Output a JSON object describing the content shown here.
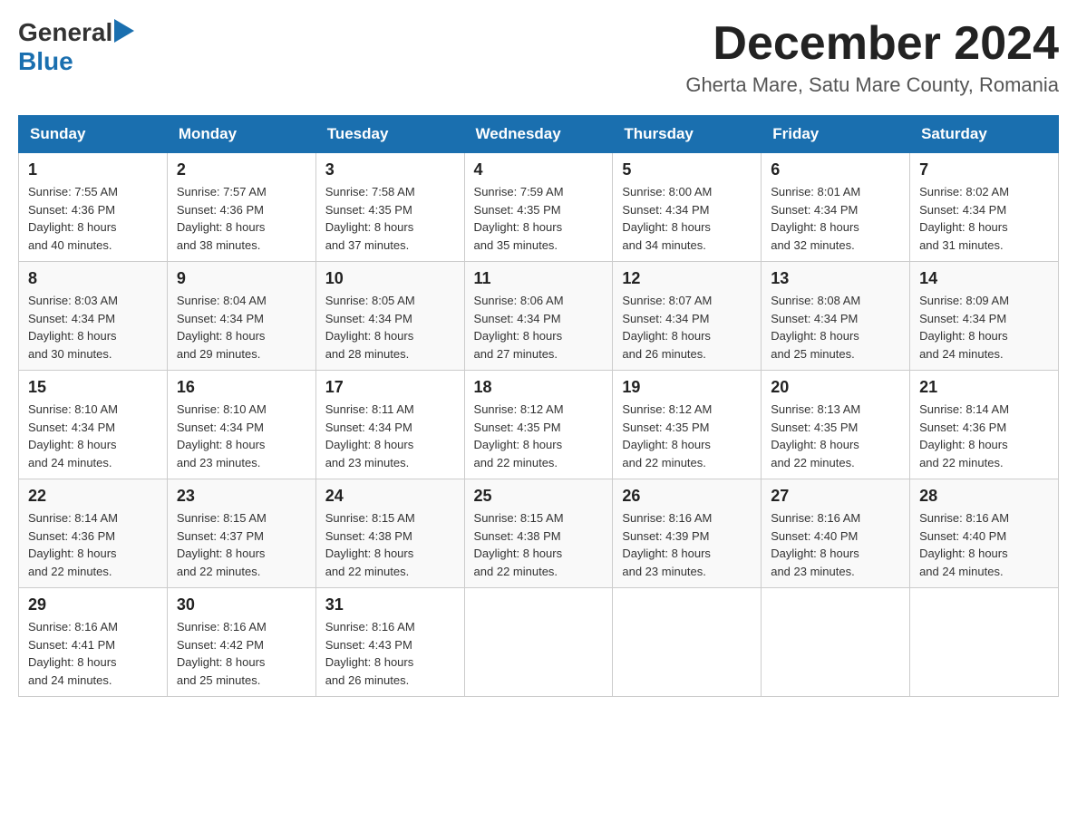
{
  "header": {
    "logo_general": "General",
    "logo_blue": "Blue",
    "month": "December 2024",
    "location": "Gherta Mare, Satu Mare County, Romania"
  },
  "weekdays": [
    "Sunday",
    "Monday",
    "Tuesday",
    "Wednesday",
    "Thursday",
    "Friday",
    "Saturday"
  ],
  "weeks": [
    [
      {
        "day": "1",
        "sunrise": "7:55 AM",
        "sunset": "4:36 PM",
        "daylight": "8 hours and 40 minutes."
      },
      {
        "day": "2",
        "sunrise": "7:57 AM",
        "sunset": "4:36 PM",
        "daylight": "8 hours and 38 minutes."
      },
      {
        "day": "3",
        "sunrise": "7:58 AM",
        "sunset": "4:35 PM",
        "daylight": "8 hours and 37 minutes."
      },
      {
        "day": "4",
        "sunrise": "7:59 AM",
        "sunset": "4:35 PM",
        "daylight": "8 hours and 35 minutes."
      },
      {
        "day": "5",
        "sunrise": "8:00 AM",
        "sunset": "4:34 PM",
        "daylight": "8 hours and 34 minutes."
      },
      {
        "day": "6",
        "sunrise": "8:01 AM",
        "sunset": "4:34 PM",
        "daylight": "8 hours and 32 minutes."
      },
      {
        "day": "7",
        "sunrise": "8:02 AM",
        "sunset": "4:34 PM",
        "daylight": "8 hours and 31 minutes."
      }
    ],
    [
      {
        "day": "8",
        "sunrise": "8:03 AM",
        "sunset": "4:34 PM",
        "daylight": "8 hours and 30 minutes."
      },
      {
        "day": "9",
        "sunrise": "8:04 AM",
        "sunset": "4:34 PM",
        "daylight": "8 hours and 29 minutes."
      },
      {
        "day": "10",
        "sunrise": "8:05 AM",
        "sunset": "4:34 PM",
        "daylight": "8 hours and 28 minutes."
      },
      {
        "day": "11",
        "sunrise": "8:06 AM",
        "sunset": "4:34 PM",
        "daylight": "8 hours and 27 minutes."
      },
      {
        "day": "12",
        "sunrise": "8:07 AM",
        "sunset": "4:34 PM",
        "daylight": "8 hours and 26 minutes."
      },
      {
        "day": "13",
        "sunrise": "8:08 AM",
        "sunset": "4:34 PM",
        "daylight": "8 hours and 25 minutes."
      },
      {
        "day": "14",
        "sunrise": "8:09 AM",
        "sunset": "4:34 PM",
        "daylight": "8 hours and 24 minutes."
      }
    ],
    [
      {
        "day": "15",
        "sunrise": "8:10 AM",
        "sunset": "4:34 PM",
        "daylight": "8 hours and 24 minutes."
      },
      {
        "day": "16",
        "sunrise": "8:10 AM",
        "sunset": "4:34 PM",
        "daylight": "8 hours and 23 minutes."
      },
      {
        "day": "17",
        "sunrise": "8:11 AM",
        "sunset": "4:34 PM",
        "daylight": "8 hours and 23 minutes."
      },
      {
        "day": "18",
        "sunrise": "8:12 AM",
        "sunset": "4:35 PM",
        "daylight": "8 hours and 22 minutes."
      },
      {
        "day": "19",
        "sunrise": "8:12 AM",
        "sunset": "4:35 PM",
        "daylight": "8 hours and 22 minutes."
      },
      {
        "day": "20",
        "sunrise": "8:13 AM",
        "sunset": "4:35 PM",
        "daylight": "8 hours and 22 minutes."
      },
      {
        "day": "21",
        "sunrise": "8:14 AM",
        "sunset": "4:36 PM",
        "daylight": "8 hours and 22 minutes."
      }
    ],
    [
      {
        "day": "22",
        "sunrise": "8:14 AM",
        "sunset": "4:36 PM",
        "daylight": "8 hours and 22 minutes."
      },
      {
        "day": "23",
        "sunrise": "8:15 AM",
        "sunset": "4:37 PM",
        "daylight": "8 hours and 22 minutes."
      },
      {
        "day": "24",
        "sunrise": "8:15 AM",
        "sunset": "4:38 PM",
        "daylight": "8 hours and 22 minutes."
      },
      {
        "day": "25",
        "sunrise": "8:15 AM",
        "sunset": "4:38 PM",
        "daylight": "8 hours and 22 minutes."
      },
      {
        "day": "26",
        "sunrise": "8:16 AM",
        "sunset": "4:39 PM",
        "daylight": "8 hours and 23 minutes."
      },
      {
        "day": "27",
        "sunrise": "8:16 AM",
        "sunset": "4:40 PM",
        "daylight": "8 hours and 23 minutes."
      },
      {
        "day": "28",
        "sunrise": "8:16 AM",
        "sunset": "4:40 PM",
        "daylight": "8 hours and 24 minutes."
      }
    ],
    [
      {
        "day": "29",
        "sunrise": "8:16 AM",
        "sunset": "4:41 PM",
        "daylight": "8 hours and 24 minutes."
      },
      {
        "day": "30",
        "sunrise": "8:16 AM",
        "sunset": "4:42 PM",
        "daylight": "8 hours and 25 minutes."
      },
      {
        "day": "31",
        "sunrise": "8:16 AM",
        "sunset": "4:43 PM",
        "daylight": "8 hours and 26 minutes."
      },
      null,
      null,
      null,
      null
    ]
  ],
  "labels": {
    "sunrise": "Sunrise:",
    "sunset": "Sunset:",
    "daylight": "Daylight:"
  }
}
